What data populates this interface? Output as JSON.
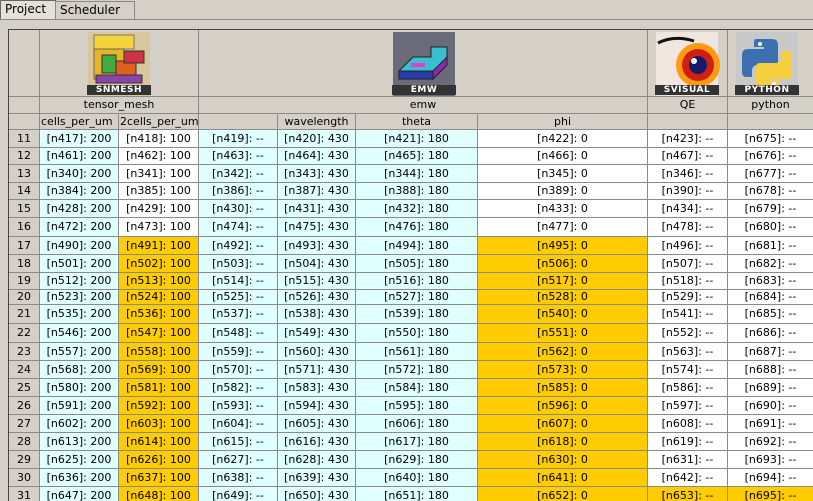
{
  "tabs": [
    {
      "label": "Project",
      "active": true
    },
    {
      "label": "Scheduler",
      "active": false
    }
  ],
  "colors": {
    "cyan": "#e0ffff",
    "gold": "#ffcc00",
    "header": "#d4d0c8"
  },
  "plugins": [
    {
      "icon": "snmesh-icon",
      "label": "SNMESH"
    },
    {
      "icon": "emw-icon",
      "label": "EMW"
    },
    {
      "icon": "svisual-icon",
      "label": "SVISUAL"
    },
    {
      "icon": "python-icon",
      "label": "PYTHON"
    }
  ],
  "tools": [
    "tensor_mesh",
    "emw",
    "QE",
    "python"
  ],
  "params": [
    "cells_per_um",
    "2cells_per_um",
    "",
    "wavelength",
    "theta",
    "phi",
    "",
    ""
  ],
  "rows": [
    {
      "n": "11",
      "cells": [
        "[n417]: 200",
        "[n418]: 100",
        "[n419]: --",
        "[n420]: 430",
        "[n421]: 180",
        "[n422]: 0",
        "[n423]: --",
        "[n675]: --"
      ],
      "hl": [
        false,
        false,
        false,
        false,
        false,
        false,
        false,
        false
      ]
    },
    {
      "n": "12",
      "cells": [
        "[n461]: 200",
        "[n462]: 100",
        "[n463]: --",
        "[n464]: 430",
        "[n465]: 180",
        "[n466]: 0",
        "[n467]: --",
        "[n676]: --"
      ],
      "hl": [
        false,
        false,
        false,
        false,
        false,
        false,
        false,
        false
      ]
    },
    {
      "n": "13",
      "cells": [
        "[n340]: 200",
        "[n341]: 100",
        "[n342]: --",
        "[n343]: 430",
        "[n344]: 180",
        "[n345]: 0",
        "[n346]: --",
        "[n677]: --"
      ],
      "hl": [
        false,
        false,
        false,
        false,
        false,
        false,
        false,
        false
      ]
    },
    {
      "n": "14",
      "cells": [
        "[n384]: 200",
        "[n385]: 100",
        "[n386]: --",
        "[n387]: 430",
        "[n388]: 180",
        "[n389]: 0",
        "[n390]: --",
        "[n678]: --"
      ],
      "hl": [
        false,
        false,
        false,
        false,
        false,
        false,
        false,
        false
      ]
    },
    {
      "n": "15",
      "cells": [
        "[n428]: 200",
        "[n429]: 100",
        "[n430]: --",
        "[n431]: 430",
        "[n432]: 180",
        "[n433]: 0",
        "[n434]: --",
        "[n679]: --"
      ],
      "hl": [
        false,
        false,
        false,
        false,
        false,
        false,
        false,
        false
      ]
    },
    {
      "n": "16",
      "cells": [
        "[n472]: 200",
        "[n473]: 100",
        "[n474]: --",
        "[n475]: 430",
        "[n476]: 180",
        "[n477]: 0",
        "[n478]: --",
        "[n680]: --"
      ],
      "hl": [
        false,
        false,
        false,
        false,
        false,
        false,
        false,
        false
      ]
    },
    {
      "n": "17",
      "cells": [
        "[n490]: 200",
        "[n491]: 100",
        "[n492]: --",
        "[n493]: 430",
        "[n494]: 180",
        "[n495]: 0",
        "[n496]: --",
        "[n681]: --"
      ],
      "hl": [
        false,
        true,
        false,
        false,
        false,
        true,
        false,
        false
      ]
    },
    {
      "n": "18",
      "cells": [
        "[n501]: 200",
        "[n502]: 100",
        "[n503]: --",
        "[n504]: 430",
        "[n505]: 180",
        "[n506]: 0",
        "[n507]: --",
        "[n682]: --"
      ],
      "hl": [
        false,
        true,
        false,
        false,
        false,
        true,
        false,
        false
      ]
    },
    {
      "n": "19",
      "cells": [
        "[n512]: 200",
        "[n513]: 100",
        "[n514]: --",
        "[n515]: 430",
        "[n516]: 180",
        "[n517]: 0",
        "[n518]: --",
        "[n683]: --"
      ],
      "hl": [
        false,
        true,
        false,
        false,
        false,
        true,
        false,
        false
      ]
    },
    {
      "n": "20",
      "cells": [
        "[n523]: 200",
        "[n524]: 100",
        "[n525]: --",
        "[n526]: 430",
        "[n527]: 180",
        "[n528]: 0",
        "[n529]: --",
        "[n684]: --"
      ],
      "hl": [
        false,
        true,
        false,
        false,
        false,
        true,
        false,
        false
      ]
    },
    {
      "n": "21",
      "cells": [
        "[n535]: 200",
        "[n536]: 100",
        "[n537]: --",
        "[n538]: 430",
        "[n539]: 180",
        "[n540]: 0",
        "[n541]: --",
        "[n685]: --"
      ],
      "hl": [
        false,
        true,
        false,
        false,
        false,
        true,
        false,
        false
      ]
    },
    {
      "n": "22",
      "cells": [
        "[n546]: 200",
        "[n547]: 100",
        "[n548]: --",
        "[n549]: 430",
        "[n550]: 180",
        "[n551]: 0",
        "[n552]: --",
        "[n686]: --"
      ],
      "hl": [
        false,
        true,
        false,
        false,
        false,
        true,
        false,
        false
      ]
    },
    {
      "n": "23",
      "cells": [
        "[n557]: 200",
        "[n558]: 100",
        "[n559]: --",
        "[n560]: 430",
        "[n561]: 180",
        "[n562]: 0",
        "[n563]: --",
        "[n687]: --"
      ],
      "hl": [
        false,
        true,
        false,
        false,
        false,
        true,
        false,
        false
      ]
    },
    {
      "n": "24",
      "cells": [
        "[n568]: 200",
        "[n569]: 100",
        "[n570]: --",
        "[n571]: 430",
        "[n572]: 180",
        "[n573]: 0",
        "[n574]: --",
        "[n688]: --"
      ],
      "hl": [
        false,
        true,
        false,
        false,
        false,
        true,
        false,
        false
      ]
    },
    {
      "n": "25",
      "cells": [
        "[n580]: 200",
        "[n581]: 100",
        "[n582]: --",
        "[n583]: 430",
        "[n584]: 180",
        "[n585]: 0",
        "[n586]: --",
        "[n689]: --"
      ],
      "hl": [
        false,
        true,
        false,
        false,
        false,
        true,
        false,
        false
      ]
    },
    {
      "n": "26",
      "cells": [
        "[n591]: 200",
        "[n592]: 100",
        "[n593]: --",
        "[n594]: 430",
        "[n595]: 180",
        "[n596]: 0",
        "[n597]: --",
        "[n690]: --"
      ],
      "hl": [
        false,
        true,
        false,
        false,
        false,
        true,
        false,
        false
      ]
    },
    {
      "n": "27",
      "cells": [
        "[n602]: 200",
        "[n603]: 100",
        "[n604]: --",
        "[n605]: 430",
        "[n606]: 180",
        "[n607]: 0",
        "[n608]: --",
        "[n691]: --"
      ],
      "hl": [
        false,
        true,
        false,
        false,
        false,
        true,
        false,
        false
      ]
    },
    {
      "n": "28",
      "cells": [
        "[n613]: 200",
        "[n614]: 100",
        "[n615]: --",
        "[n616]: 430",
        "[n617]: 180",
        "[n618]: 0",
        "[n619]: --",
        "[n692]: --"
      ],
      "hl": [
        false,
        true,
        false,
        false,
        false,
        true,
        false,
        false
      ]
    },
    {
      "n": "29",
      "cells": [
        "[n625]: 200",
        "[n626]: 100",
        "[n627]: --",
        "[n628]: 430",
        "[n629]: 180",
        "[n630]: 0",
        "[n631]: --",
        "[n693]: --"
      ],
      "hl": [
        false,
        true,
        false,
        false,
        false,
        true,
        false,
        false
      ]
    },
    {
      "n": "30",
      "cells": [
        "[n636]: 200",
        "[n637]: 100",
        "[n638]: --",
        "[n639]: 430",
        "[n640]: 180",
        "[n641]: 0",
        "[n642]: --",
        "[n694]: --"
      ],
      "hl": [
        false,
        true,
        false,
        false,
        false,
        true,
        false,
        false
      ]
    },
    {
      "n": "31",
      "cells": [
        "[n647]: 200",
        "[n648]: 100",
        "[n649]: --",
        "[n650]: 430",
        "[n651]: 180",
        "[n652]: 0",
        "[n653]: --",
        "[n695]: --"
      ],
      "hl": [
        false,
        true,
        false,
        false,
        false,
        true,
        true,
        true
      ]
    }
  ]
}
